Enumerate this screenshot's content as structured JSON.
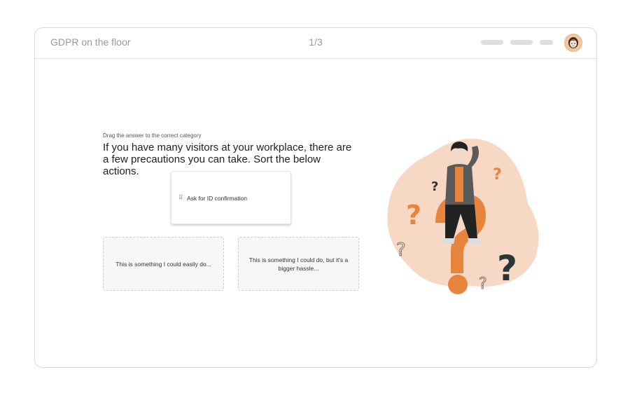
{
  "header": {
    "title": "GDPR on the floor",
    "progress": "1/3"
  },
  "question": {
    "instruction": "Drag the answer to the correct category",
    "text": "If you have many visitors at your workplace, there are a few precautions you can take. Sort the below actions."
  },
  "draggable": {
    "handle": "⠿",
    "label": "Ask for ID confirmation"
  },
  "categories": [
    {
      "label": "This is something I could easily do..."
    },
    {
      "label": "This is something I could do, but it's a bigger hassle..."
    }
  ],
  "colors": {
    "accent": "#E8853D",
    "blob": "#F6D8C5",
    "dark": "#2D3436"
  },
  "icons": [
    "avatar",
    "drag-handle-icon",
    "question-illustration"
  ]
}
